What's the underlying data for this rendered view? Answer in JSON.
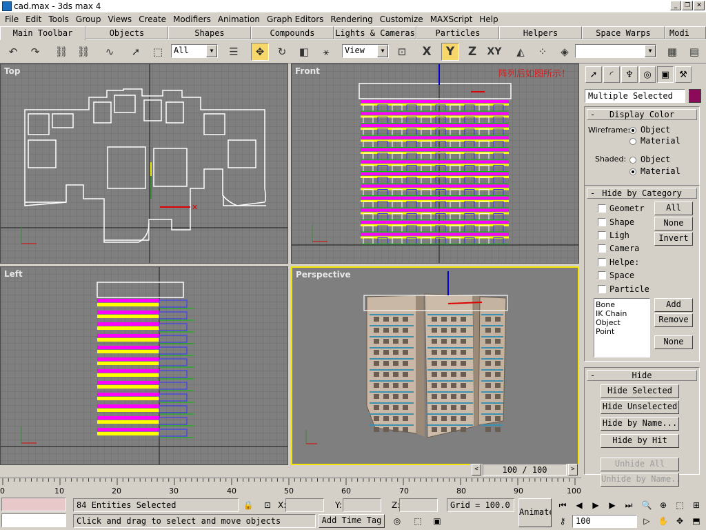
{
  "window": {
    "title": "cad.max - 3ds max 4"
  },
  "menu": [
    "File",
    "Edit",
    "Tools",
    "Group",
    "Views",
    "Create",
    "Modifiers",
    "Animation",
    "Graph Editors",
    "Rendering",
    "Customize",
    "MAXScript",
    "Help"
  ],
  "tabs": [
    "Main Toolbar",
    "Objects",
    "Shapes",
    "Compounds",
    "Lights & Cameras",
    "Particles",
    "Helpers",
    "Space Warps",
    "Modi"
  ],
  "toolbar": {
    "selection_filter": "All",
    "ref_coord": "View",
    "axis_x": "X",
    "axis_y": "Y",
    "axis_z": "Z",
    "axis_xy": "XY",
    "named_selection": ""
  },
  "viewports": {
    "top": "Top",
    "front": "Front",
    "left": "Left",
    "perspective": "Perspective",
    "annotation": "阵列后如图所示！"
  },
  "panel": {
    "selection_name": "Multiple Selected",
    "selection_color": "#8b0a5a",
    "display_color": {
      "title": "Display Color",
      "wireframe_label": "Wireframe:",
      "shaded_label": "Shaded:",
      "object": "Object",
      "material": "Material",
      "wireframe_value": "Object",
      "shaded_value": "Material"
    },
    "hide_by_category": {
      "title": "Hide by Category",
      "items": [
        "Geometr",
        "Shape",
        "Ligh",
        "Camera",
        "Helpe:",
        "Space",
        "Particle"
      ],
      "all": "All",
      "none": "None",
      "invert": "Invert",
      "list": [
        "Bone",
        "IK Chain Object",
        "Point"
      ],
      "add": "Add",
      "remove": "Remove",
      "none2": "None"
    },
    "hide": {
      "title": "Hide",
      "hide_selected": "Hide Selected",
      "hide_unselected": "Hide Unselected",
      "hide_by_name": "Hide by Name...",
      "hide_by_hit": "Hide by Hit",
      "unhide_all": "Unhide All",
      "unhide_by_name": "Unhide by Name..."
    }
  },
  "timeslider": {
    "label": "100 / 100"
  },
  "ruler": {
    "ticks": [
      "0",
      "10",
      "20",
      "30",
      "40",
      "50",
      "60",
      "70",
      "80",
      "90",
      "100"
    ]
  },
  "status": {
    "entities": "84 Entities Selected",
    "prompt": "Click and drag to select and move objects",
    "x_label": "X:",
    "y_label": "Y:",
    "z_label": "Z:",
    "grid": "Grid = 100.0",
    "add_time_tag": "Add Time Tag",
    "animate": "Animate",
    "frame": "100"
  }
}
